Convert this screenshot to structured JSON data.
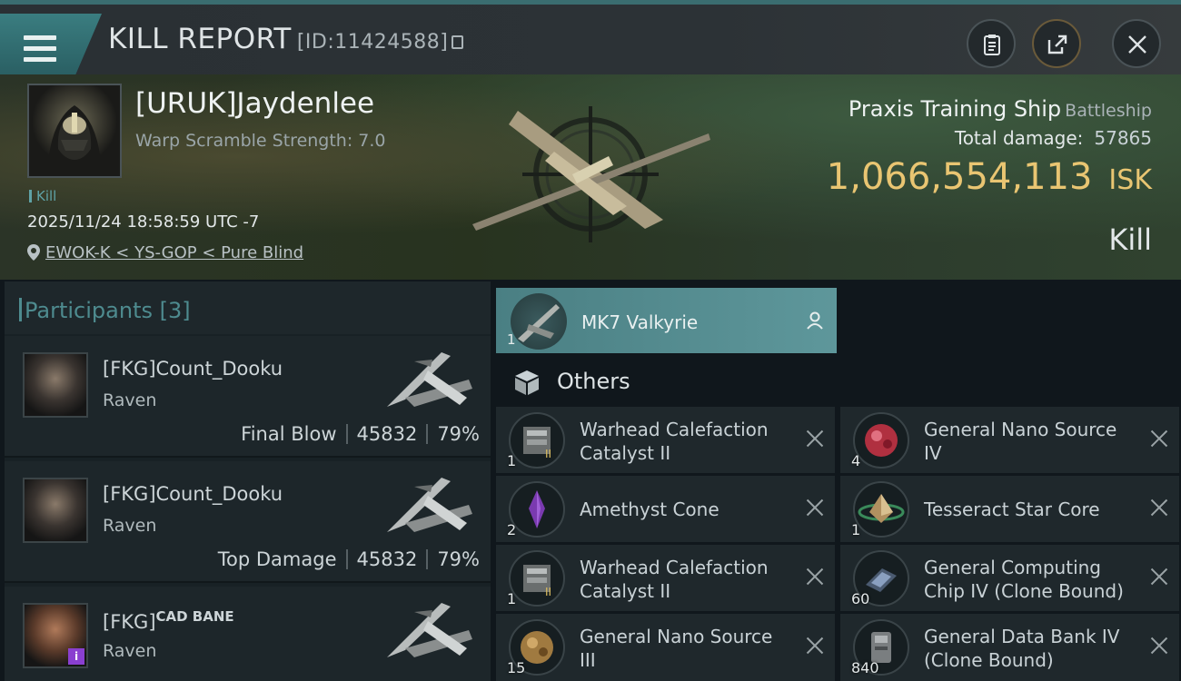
{
  "header": {
    "title": "KILL REPORT",
    "report_id": "[ID:11424588]"
  },
  "victim": {
    "name": "[URUK]Jaydenlee",
    "warp_scramble": "Warp Scramble Strength: 7.0",
    "tag": "Kill",
    "datetime": "2025/11/24 18:58:59 UTC -7",
    "location": "EWOK-K < YS-GOP < Pure Blind",
    "ship_name": "Praxis Training Ship",
    "ship_class": "Battleship",
    "total_damage_label": "Total damage:",
    "total_damage": "57865",
    "isk_value": "1,066,554,113",
    "isk_unit": "ISK",
    "result": "Kill"
  },
  "participants": {
    "title": "Participants",
    "count": "[3]",
    "items": [
      {
        "name": "[FKG]Count_Dooku",
        "ship": "Raven",
        "label": "Final Blow",
        "damage": "45832",
        "percent": "79%"
      },
      {
        "name": "[FKG]Count_Dooku",
        "ship": "Raven",
        "label": "Top Damage",
        "damage": "45832",
        "percent": "79%"
      },
      {
        "name_prefix": "[FKG]",
        "name_sup": "CAD BANE",
        "ship": "Raven"
      }
    ]
  },
  "selected_ship": {
    "name": "MK7  Valkyrie",
    "qty": "1"
  },
  "others": {
    "title": "Others",
    "items": [
      {
        "name": "Warhead Calefaction Catalyst II",
        "qty": "1",
        "icon": "warhead-icon"
      },
      {
        "name": "General Nano Source IV",
        "qty": "4",
        "icon": "nano-source-red-icon"
      },
      {
        "name": "Amethyst Cone",
        "qty": "2",
        "icon": "crystal-icon"
      },
      {
        "name": "Tesseract Star Core",
        "qty": "1",
        "icon": "star-core-icon"
      },
      {
        "name": "Warhead Calefaction Catalyst II",
        "qty": "1",
        "icon": "warhead-icon"
      },
      {
        "name": "General Computing Chip IV (Clone Bound)",
        "qty": "60",
        "icon": "chip-icon"
      },
      {
        "name": "General Nano Source III",
        "qty": "15",
        "icon": "nano-source-gold-icon"
      },
      {
        "name": "General Data Bank IV (Clone Bound)",
        "qty": "840",
        "icon": "data-bank-icon"
      }
    ]
  }
}
